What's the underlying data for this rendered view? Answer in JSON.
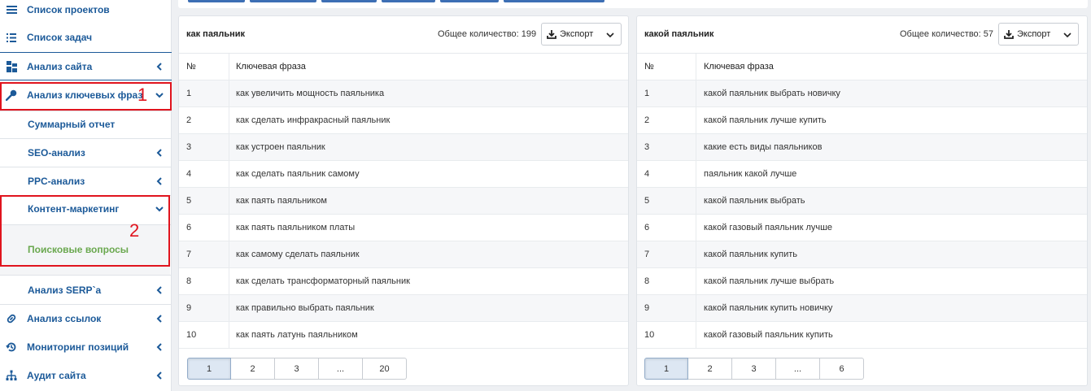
{
  "sidebar": {
    "items": [
      {
        "label": "Список проектов",
        "icon": "list-icon"
      },
      {
        "label": "Список задач",
        "icon": "task-list-icon"
      },
      {
        "label": "Анализ сайта",
        "icon": "site-analysis-icon"
      },
      {
        "label": "Анализ ключевых фраз",
        "icon": "key-icon"
      },
      {
        "label": "Суммарный отчет"
      },
      {
        "label": "SEO-анализ"
      },
      {
        "label": "PPC-анализ"
      },
      {
        "label": "Контент-маркетинг"
      },
      {
        "label": "Поисковые вопросы"
      },
      {
        "label": "Анализ SERP`a"
      },
      {
        "label": "Анализ ссылок",
        "icon": "link-icon"
      },
      {
        "label": "Мониторинг позиций",
        "icon": "history-icon"
      },
      {
        "label": "Аудит сайта",
        "icon": "sitemap-icon"
      }
    ],
    "annotations": [
      "1",
      "2"
    ]
  },
  "panels": [
    {
      "title": "как паяльник",
      "count_label": "Общее количество: 199",
      "export_label": "Экспорт",
      "col_num": "№",
      "col_phrase": "Ключевая фраза",
      "rows": [
        {
          "n": "1",
          "phrase": "как увеличить мощность паяльника"
        },
        {
          "n": "2",
          "phrase": "как сделать инфракрасный паяльник"
        },
        {
          "n": "3",
          "phrase": "как устроен паяльник"
        },
        {
          "n": "4",
          "phrase": "как сделать паяльник самому"
        },
        {
          "n": "5",
          "phrase": "как паять паяльником"
        },
        {
          "n": "6",
          "phrase": "как паять паяльником платы"
        },
        {
          "n": "7",
          "phrase": "как самому сделать паяльник"
        },
        {
          "n": "8",
          "phrase": "как сделать трансформаторный паяльник"
        },
        {
          "n": "9",
          "phrase": "как правильно выбрать паяльник"
        },
        {
          "n": "10",
          "phrase": "как паять латунь паяльником"
        }
      ],
      "pages": [
        "1",
        "2",
        "3",
        "...",
        "20"
      ]
    },
    {
      "title": "какой паяльник",
      "count_label": "Общее количество: 57",
      "export_label": "Экспорт",
      "col_num": "№",
      "col_phrase": "Ключевая фраза",
      "rows": [
        {
          "n": "1",
          "phrase": "какой паяльник выбрать новичку"
        },
        {
          "n": "2",
          "phrase": "какой паяльник лучше купить"
        },
        {
          "n": "3",
          "phrase": "какие есть виды паяльников"
        },
        {
          "n": "4",
          "phrase": "паяльник какой лучше"
        },
        {
          "n": "5",
          "phrase": "какой паяльник выбрать"
        },
        {
          "n": "6",
          "phrase": "какой газовый паяльник лучше"
        },
        {
          "n": "7",
          "phrase": "какой паяльник купить"
        },
        {
          "n": "8",
          "phrase": "какой паяльник лучше выбрать"
        },
        {
          "n": "9",
          "phrase": "какой паяльник купить новичку"
        },
        {
          "n": "10",
          "phrase": "какой газовый паяльник купить"
        }
      ],
      "pages": [
        "1",
        "2",
        "3",
        "...",
        "6"
      ]
    }
  ],
  "colors": {
    "nav_text": "#1c5a99",
    "active_link": "#6aa84f",
    "annotation_red": "#e0141e",
    "active_page_bg": "#dde7f3"
  }
}
